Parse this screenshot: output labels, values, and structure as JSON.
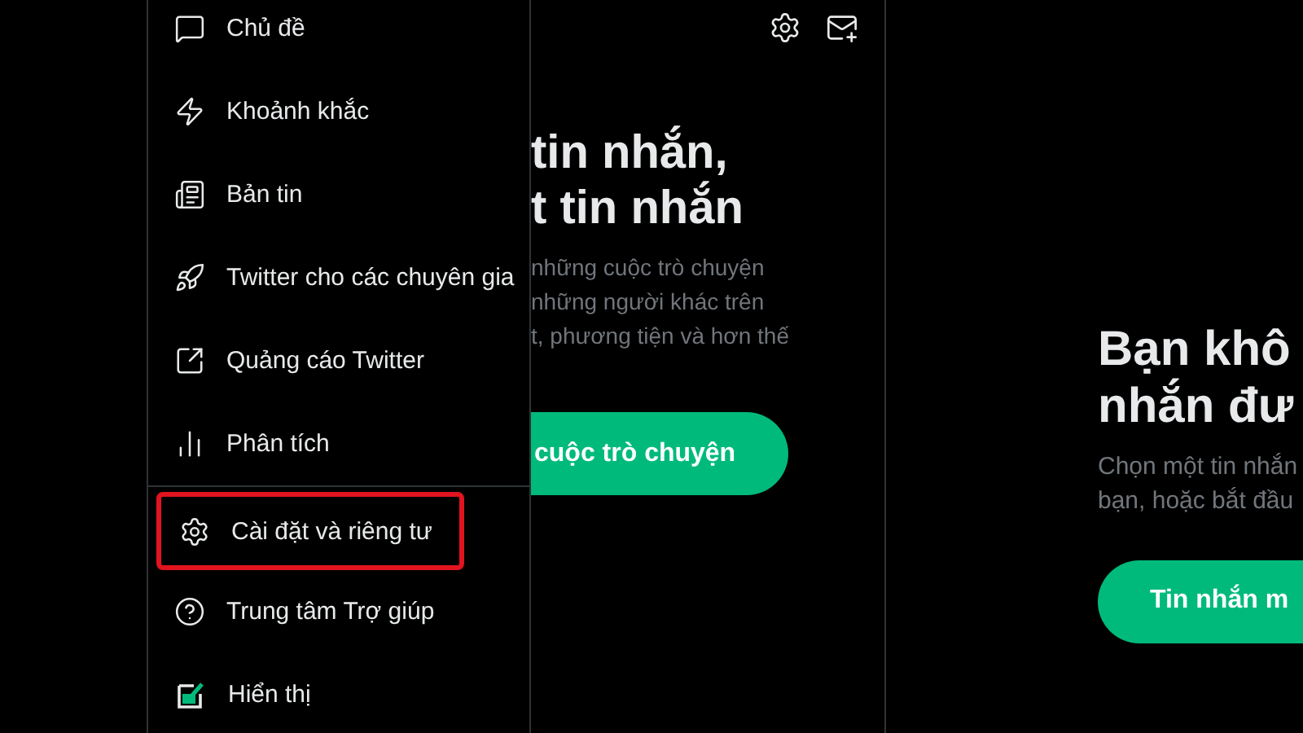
{
  "menu": {
    "groups": [
      {
        "items": [
          {
            "label": "Chủ đề",
            "highlighted": false
          },
          {
            "label": "Khoảnh khắc",
            "highlighted": false
          },
          {
            "label": "Bản tin",
            "highlighted": false
          },
          {
            "label": "Twitter cho các chuyên gia",
            "highlighted": false
          },
          {
            "label": "Quảng cáo Twitter",
            "highlighted": false
          },
          {
            "label": "Phân tích",
            "highlighted": false
          }
        ]
      },
      {
        "items": [
          {
            "label": "Cài đặt và riêng tư",
            "highlighted": true
          },
          {
            "label": "Trung tâm Trợ giúp",
            "highlighted": false
          },
          {
            "label": "Hiển thị",
            "highlighted": false
          }
        ]
      }
    ]
  },
  "messages_panel": {
    "heading": [
      "tin nhắn,",
      "t tin nhắn"
    ],
    "body": [
      "những cuộc trò chuyện",
      "những người khác trên",
      "t, phương tiện và hơn thế"
    ],
    "button": "cuộc trò chuyện"
  },
  "detail_panel": {
    "heading": [
      "Bạn khô",
      "nhắn đư"
    ],
    "body": [
      "Chọn một tin nhắn",
      "bạn, hoặc bắt đầu"
    ],
    "button": "Tin nhắn m"
  }
}
